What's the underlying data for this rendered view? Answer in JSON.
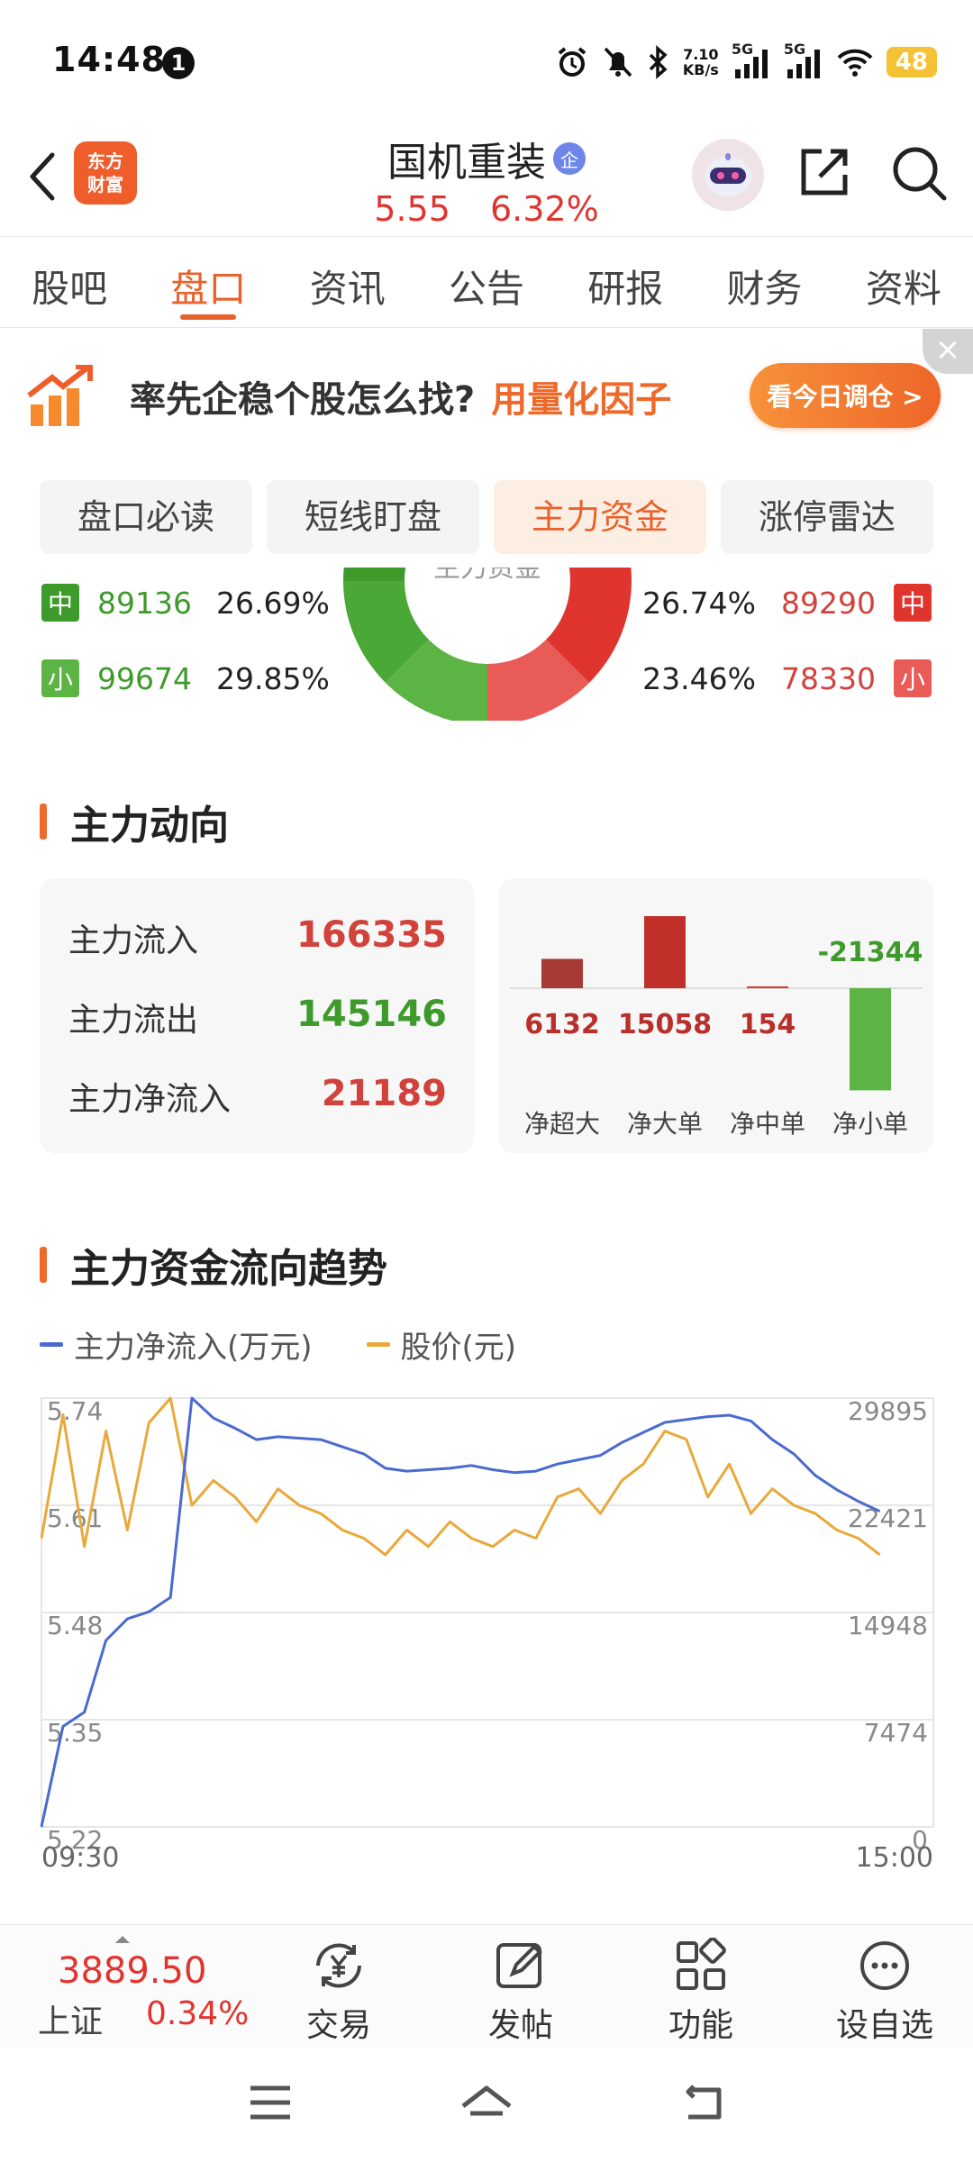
{
  "status_bar": {
    "time": "14:48",
    "notification_count": "1",
    "net_speed_value": "7.10",
    "net_speed_unit": "KB/s",
    "signal_1": "5G",
    "signal_2": "5G",
    "battery": "48"
  },
  "header": {
    "logo_line1": "东方",
    "logo_line2": "财富",
    "stock_name": "国机重装",
    "badge": "企",
    "price": "5.55",
    "change_pct": "6.32%"
  },
  "tabs": [
    {
      "label": "股吧",
      "active": false
    },
    {
      "label": "盘口",
      "active": true
    },
    {
      "label": "资讯",
      "active": false
    },
    {
      "label": "公告",
      "active": false
    },
    {
      "label": "研报",
      "active": false
    },
    {
      "label": "财务",
      "active": false
    },
    {
      "label": "资料",
      "active": false
    }
  ],
  "banner": {
    "text": "率先企稳个股怎么找?",
    "highlight": "用量化因子",
    "button": "看今日调仓 >"
  },
  "subtabs": [
    {
      "label": "盘口必读",
      "active": false
    },
    {
      "label": "短线盯盘",
      "active": false
    },
    {
      "label": "主力资金",
      "active": true
    },
    {
      "label": "涨停雷达",
      "active": false
    }
  ],
  "donut": {
    "center_label": "主力资金",
    "left": [
      {
        "badge": "中",
        "value": "89136",
        "pct": "26.69%"
      },
      {
        "badge": "小",
        "value": "99674",
        "pct": "29.85%"
      }
    ],
    "right": [
      {
        "badge": "中",
        "value": "89290",
        "pct": "26.74%"
      },
      {
        "badge": "小",
        "value": "78330",
        "pct": "23.46%"
      }
    ]
  },
  "main_flow": {
    "title": "主力动向",
    "rows": [
      {
        "label": "主力流入",
        "value": "166335",
        "color": "#d1423c"
      },
      {
        "label": "主力流出",
        "value": "145146",
        "color": "#3f9a2c"
      },
      {
        "label": "主力净流入",
        "value": "21189",
        "color": "#d1423c"
      }
    ],
    "bars": [
      {
        "label": "净超大",
        "value": 6132
      },
      {
        "label": "净大单",
        "value": 15058
      },
      {
        "label": "净中单",
        "value": 154
      },
      {
        "label": "净小单",
        "value": -21344
      }
    ]
  },
  "trend": {
    "title": "主力资金流向趋势",
    "legend_flow": "主力净流入(万元)",
    "legend_price": "股价(元)",
    "flow_color": "#4a6ad0",
    "price_color": "#e9a93a"
  },
  "chart_data": {
    "type": "line",
    "x_start": "09:30",
    "x_end": "15:00",
    "y_left_ticks": [
      "5.74",
      "5.61",
      "5.48",
      "5.35",
      "5.22"
    ],
    "y_right_ticks": [
      "29895",
      "22421",
      "14948",
      "7474",
      "0"
    ],
    "y_left_range": [
      5.22,
      5.74
    ],
    "y_right_range": [
      0,
      29895
    ],
    "grid": true,
    "series": [
      {
        "name": "主力净流入(万元)",
        "axis": "right",
        "values": [
          0,
          7000,
          8000,
          13000,
          14500,
          15000,
          16000,
          29895,
          28500,
          27800,
          27000,
          27200,
          27100,
          27000,
          26500,
          26000,
          25000,
          24800,
          24900,
          25000,
          25200,
          24900,
          24700,
          24800,
          25300,
          25600,
          25900,
          26800,
          27500,
          28200,
          28400,
          28600,
          28700,
          28300,
          27000,
          26000,
          24500,
          23500,
          22700,
          22000
        ]
      },
      {
        "name": "股价(元)",
        "axis": "left",
        "values": [
          5.57,
          5.72,
          5.56,
          5.7,
          5.58,
          5.71,
          5.74,
          5.61,
          5.64,
          5.62,
          5.59,
          5.63,
          5.61,
          5.6,
          5.58,
          5.57,
          5.55,
          5.58,
          5.56,
          5.59,
          5.57,
          5.56,
          5.58,
          5.57,
          5.62,
          5.63,
          5.6,
          5.64,
          5.66,
          5.7,
          5.69,
          5.62,
          5.66,
          5.6,
          5.63,
          5.61,
          5.6,
          5.58,
          5.57,
          5.55
        ]
      }
    ]
  },
  "bottom_bar": {
    "index_value": "3889.50",
    "index_name": "上证",
    "index_pct": "0.34%",
    "buttons": [
      "交易",
      "发帖",
      "功能",
      "设自选"
    ]
  }
}
